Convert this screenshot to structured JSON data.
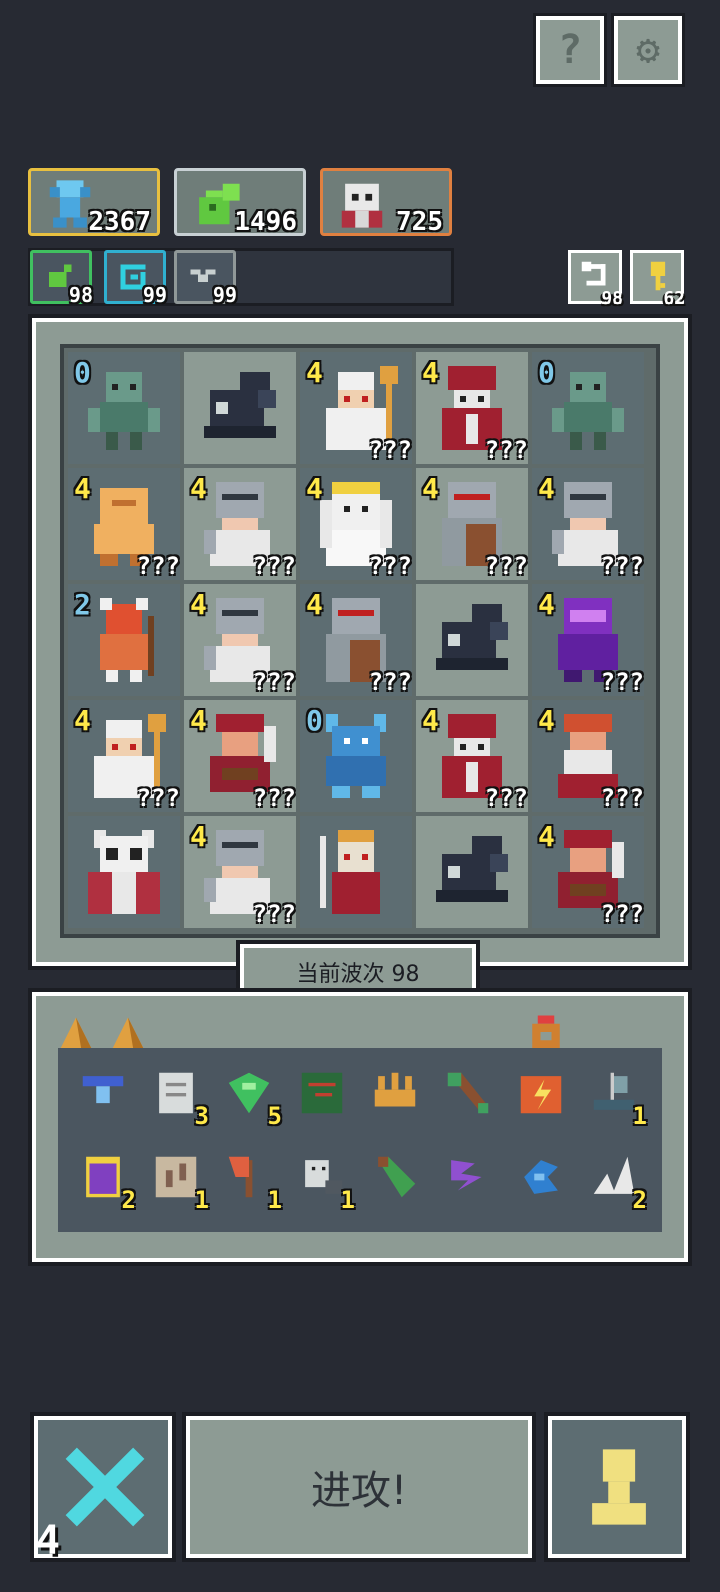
{
  "top_buttons": {
    "help_glyph": "?",
    "settings_glyph": "⚙"
  },
  "resources": [
    {
      "name": "crystal",
      "value": "2367",
      "border": "#e8c040"
    },
    {
      "name": "slime",
      "value": "1496",
      "border": "#c8d0d4"
    },
    {
      "name": "skull",
      "value": "725",
      "border": "#e08040"
    }
  ],
  "mini_resources": [
    {
      "name": "green",
      "value": "98",
      "border": "#40c060"
    },
    {
      "name": "cyan",
      "value": "99",
      "border": "#30b0d0"
    },
    {
      "name": "gray",
      "value": "99",
      "border": "#909898"
    }
  ],
  "side_buttons": {
    "refresh_count": "98",
    "key_count": "62"
  },
  "board": {
    "cells": [
      {
        "shade": "dark",
        "icon": "zombie-icon",
        "level": "0",
        "level_color": "#80c8e8",
        "q": ""
      },
      {
        "shade": "light",
        "icon": "wind-icon",
        "level": "",
        "level_color": "#ffe94a",
        "q": ""
      },
      {
        "shade": "dark",
        "icon": "priest-icon",
        "level": "4",
        "level_color": "#ffe94a",
        "q": "???"
      },
      {
        "shade": "light",
        "icon": "redcloak-icon",
        "level": "4",
        "level_color": "#ffe94a",
        "q": "???"
      },
      {
        "shade": "dark",
        "icon": "zombie-icon",
        "level": "0",
        "level_color": "#80c8e8",
        "q": ""
      },
      {
        "shade": "dark",
        "icon": "golem-icon",
        "level": "4",
        "level_color": "#ffe94a",
        "q": "???"
      },
      {
        "shade": "light",
        "icon": "knight-icon",
        "level": "4",
        "level_color": "#ffe94a",
        "q": "???"
      },
      {
        "shade": "dark",
        "icon": "angel-icon",
        "level": "4",
        "level_color": "#ffe94a",
        "q": "???"
      },
      {
        "shade": "light",
        "icon": "shieldknight-icon",
        "level": "4",
        "level_color": "#ffe94a",
        "q": "???"
      },
      {
        "shade": "dark",
        "icon": "knight-icon",
        "level": "4",
        "level_color": "#ffe94a",
        "q": "???"
      },
      {
        "shade": "dark",
        "icon": "beast-icon",
        "level": "2",
        "level_color": "#80c8e8",
        "q": ""
      },
      {
        "shade": "light",
        "icon": "knight-icon",
        "level": "4",
        "level_color": "#ffe94a",
        "q": "???"
      },
      {
        "shade": "dark",
        "icon": "shieldknight-icon",
        "level": "4",
        "level_color": "#ffe94a",
        "q": "???"
      },
      {
        "shade": "light",
        "icon": "wind-icon",
        "level": "",
        "level_color": "#ffe94a",
        "q": ""
      },
      {
        "shade": "dark",
        "icon": "purpleknight-icon",
        "level": "4",
        "level_color": "#ffe94a",
        "q": "???"
      },
      {
        "shade": "dark",
        "icon": "priest-icon",
        "level": "4",
        "level_color": "#ffe94a",
        "q": "???"
      },
      {
        "shade": "light",
        "icon": "warrior-icon",
        "level": "4",
        "level_color": "#ffe94a",
        "q": "???"
      },
      {
        "shade": "dark",
        "icon": "demon-icon",
        "level": "0",
        "level_color": "#80c8e8",
        "q": ""
      },
      {
        "shade": "light",
        "icon": "redcloak-icon",
        "level": "4",
        "level_color": "#ffe94a",
        "q": "???"
      },
      {
        "shade": "dark",
        "icon": "dwarf-icon",
        "level": "4",
        "level_color": "#ffe94a",
        "q": "???"
      },
      {
        "shade": "dark",
        "icon": "skullking-icon",
        "level": "",
        "level_color": "#ffe94a",
        "q": ""
      },
      {
        "shade": "light",
        "icon": "knight-icon",
        "level": "4",
        "level_color": "#ffe94a",
        "q": "???"
      },
      {
        "shade": "dark",
        "icon": "skeletonlord-icon",
        "level": "",
        "level_color": "#ffe94a",
        "q": ""
      },
      {
        "shade": "light",
        "icon": "wind-icon",
        "level": "",
        "level_color": "#ffe94a",
        "q": ""
      },
      {
        "shade": "dark",
        "icon": "warrior-icon",
        "level": "4",
        "level_color": "#ffe94a",
        "q": "???"
      }
    ]
  },
  "wave_label": "当前波次 98",
  "inventory": {
    "tabs": [
      {
        "icon": "cheese-icon"
      },
      {
        "icon": "cheese-icon"
      }
    ],
    "ring_icon": "ring-icon",
    "items": [
      {
        "icon": "amulet-icon",
        "count": "",
        "color": "#4060d0"
      },
      {
        "icon": "scroll-icon",
        "count": "3",
        "color": "#d8dcdc"
      },
      {
        "icon": "gem-icon",
        "count": "5",
        "color": "#40c060"
      },
      {
        "icon": "vine-book-icon",
        "count": "",
        "color": "#2a6a3a"
      },
      {
        "icon": "crown-icon",
        "count": "",
        "color": "#e0a040"
      },
      {
        "icon": "arrow-icon",
        "count": "",
        "color": "#40a060"
      },
      {
        "icon": "box-icon",
        "count": "",
        "color": "#e06030"
      },
      {
        "icon": "ship-icon",
        "count": "1",
        "color": "#80a0a8"
      },
      {
        "icon": "potion-jar-icon",
        "count": "2",
        "color": "#8040c0"
      },
      {
        "icon": "map-icon",
        "count": "1",
        "color": "#c8b8a0"
      },
      {
        "icon": "axe-icon",
        "count": "1",
        "color": "#e06040"
      },
      {
        "icon": "ghost-icon",
        "count": "1",
        "color": "#d8dcdc"
      },
      {
        "icon": "vial-icon",
        "count": "",
        "color": "#40a050"
      },
      {
        "icon": "claw-icon",
        "count": "",
        "color": "#9050d0"
      },
      {
        "icon": "wave-icon",
        "count": "",
        "color": "#3080d0"
      },
      {
        "icon": "horn-icon",
        "count": "2",
        "color": "#e8e8e8"
      }
    ]
  },
  "bottom": {
    "attack_label": "进攻!",
    "corner_count": "4"
  }
}
